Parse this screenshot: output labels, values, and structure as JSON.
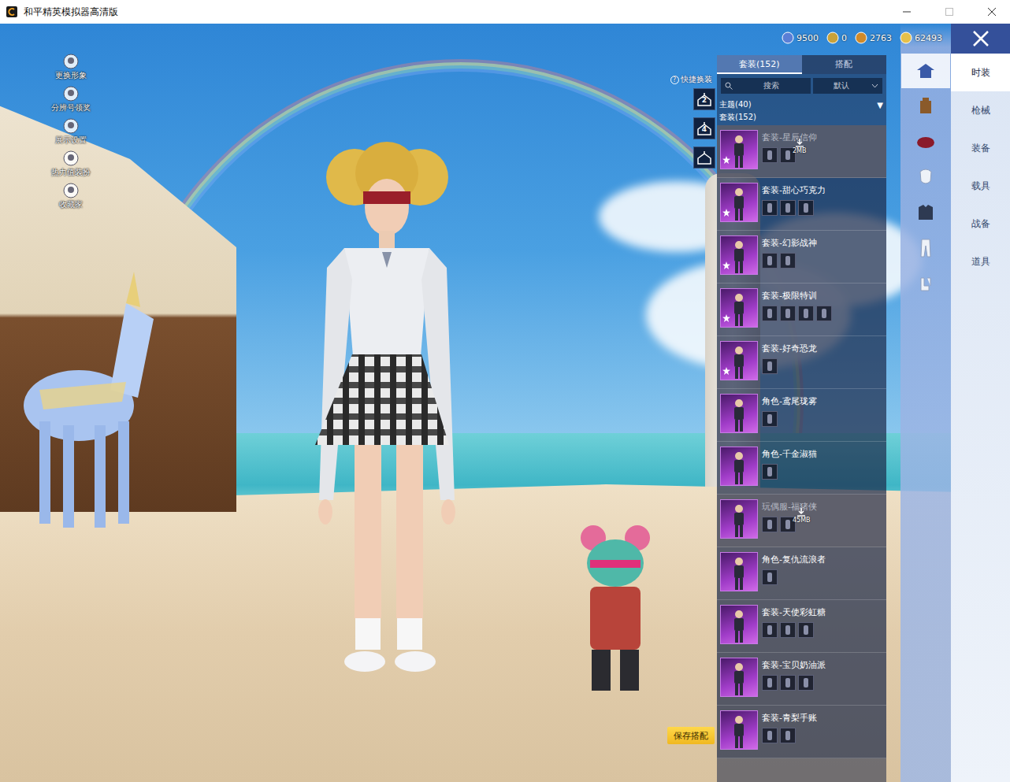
{
  "window": {
    "title": "和平精英模拟器高清版"
  },
  "side_menu": [
    {
      "label": "更换形象"
    },
    {
      "label": "分辨号领奖"
    },
    {
      "label": "展示设置"
    },
    {
      "label": "热力值装扮"
    },
    {
      "label": "收藏家"
    }
  ],
  "currencies": [
    {
      "amount": "9500",
      "color": "#5a7fd6"
    },
    {
      "amount": "0",
      "color": "#c9a23a"
    },
    {
      "amount": "2763",
      "color": "#d08a2a"
    },
    {
      "amount": "62493",
      "color": "#e6c04a"
    }
  ],
  "quick_change": {
    "label": "快捷换装",
    "help": "?",
    "slots": [
      {
        "number": "2",
        "kind": "numbered"
      },
      {
        "number": "4",
        "kind": "numbered"
      },
      {
        "kind": "plain"
      }
    ]
  },
  "list_tabs": [
    {
      "label": "套装(152)",
      "selected": true
    },
    {
      "label": "搭配",
      "selected": false
    }
  ],
  "search": {
    "placeholder": "搜索",
    "sort": "默认"
  },
  "filters": {
    "theme": "主题(40)",
    "theme_arrow": "▼",
    "section": "套装(152)"
  },
  "outfits": [
    {
      "name": "套装-星辰信仰",
      "downloaded": false,
      "size": "2MB",
      "starred": true,
      "parts": 2
    },
    {
      "name": "套装-甜心巧克力",
      "downloaded": true,
      "starred": true,
      "parts": 3
    },
    {
      "name": "套装-幻影战神",
      "downloaded": true,
      "starred": true,
      "parts": 2
    },
    {
      "name": "套装-极限特训",
      "downloaded": true,
      "starred": true,
      "parts": 4
    },
    {
      "name": "套装-好奇恐龙",
      "downloaded": true,
      "starred": true,
      "parts": 1
    },
    {
      "name": "角色-鸢尾珑雾",
      "downloaded": true,
      "starred": false,
      "parts": 1
    },
    {
      "name": "角色-千金淑猫",
      "downloaded": true,
      "starred": false,
      "parts": 1
    },
    {
      "name": "玩偶服-福猪侠",
      "downloaded": false,
      "size": "45MB",
      "starred": false,
      "parts": 2
    },
    {
      "name": "角色-复仇流浪者",
      "downloaded": true,
      "starred": false,
      "parts": 1
    },
    {
      "name": "套装-天使彩虹糖",
      "downloaded": true,
      "starred": false,
      "parts": 3
    },
    {
      "name": "套装-宝贝奶油派",
      "downloaded": true,
      "starred": false,
      "parts": 3
    },
    {
      "name": "套装-青梨手账",
      "downloaded": true,
      "starred": false,
      "parts": 2
    }
  ],
  "categories": [
    {
      "selected": true
    },
    {
      "selected": false
    },
    {
      "selected": false
    },
    {
      "selected": false
    },
    {
      "selected": false
    },
    {
      "selected": false
    },
    {
      "selected": false
    }
  ],
  "nav": [
    {
      "label": "时装",
      "selected": true
    },
    {
      "label": "枪械",
      "selected": false
    },
    {
      "label": "装备",
      "selected": false
    },
    {
      "label": "载具",
      "selected": false
    },
    {
      "label": "战备",
      "selected": false
    },
    {
      "label": "道具",
      "selected": false
    }
  ],
  "save_button": "保存搭配"
}
